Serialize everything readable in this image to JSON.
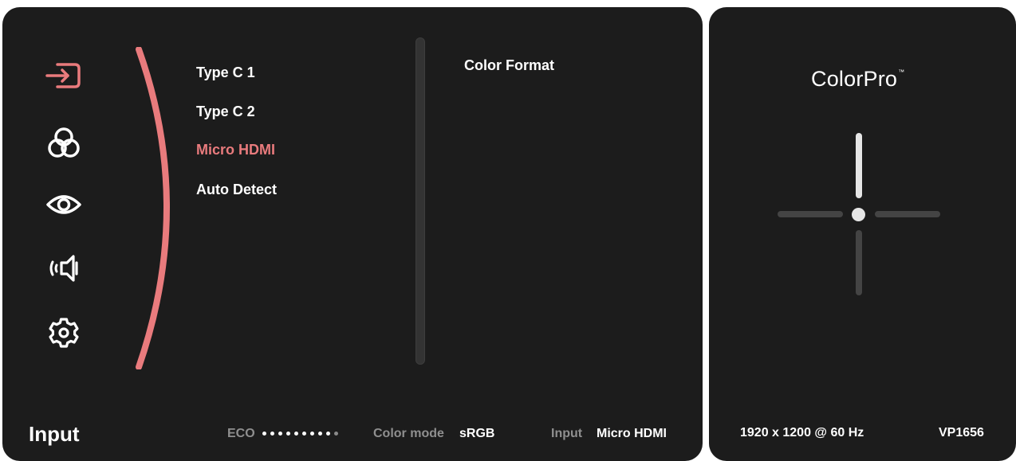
{
  "sidebar": {
    "items": [
      {
        "icon": "input-icon",
        "active": true
      },
      {
        "icon": "color-adjust-icon",
        "active": false
      },
      {
        "icon": "view-mode-icon",
        "active": false
      },
      {
        "icon": "audio-icon",
        "active": false
      },
      {
        "icon": "settings-gear-icon",
        "active": false
      }
    ]
  },
  "menu": {
    "items": [
      "Type C 1",
      "Type C 2",
      "Micro HDMI",
      "Auto Detect"
    ],
    "selected": "Micro HDMI"
  },
  "submenu": {
    "title": "Color Format"
  },
  "footer": {
    "section_title": "Input",
    "eco_label": "ECO",
    "eco_level": 9,
    "eco_max": 10,
    "color_mode_label": "Color mode",
    "color_mode_value": "sRGB",
    "input_label": "Input",
    "input_value": "Micro HDMI"
  },
  "side_panel": {
    "brand": "ColorPro",
    "brand_mark": "™",
    "resolution": "1920 x 1200 @ 60 Hz",
    "model": "VP1656"
  },
  "colors": {
    "accent": "#e97b7d",
    "panel": "#1c1c1c",
    "muted": "#8f8f8f"
  }
}
